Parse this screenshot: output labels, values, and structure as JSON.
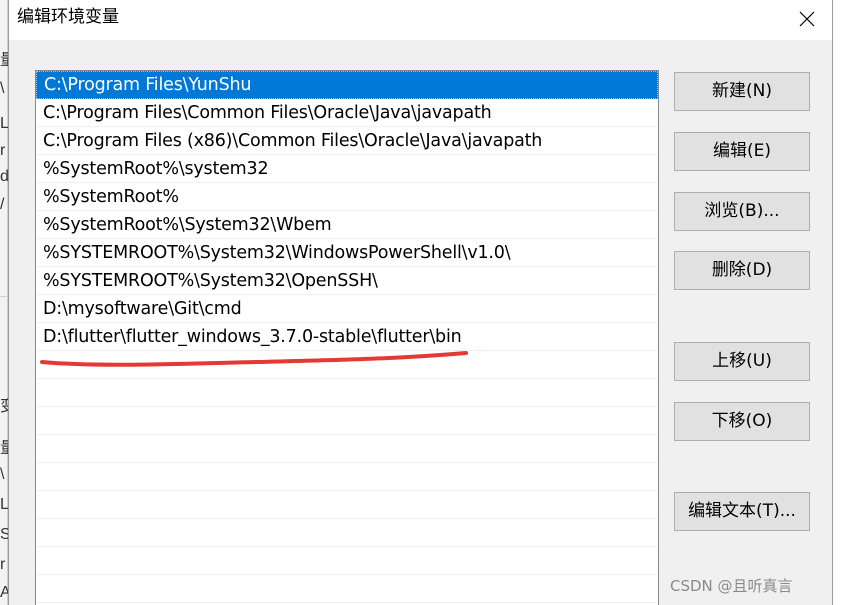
{
  "dialog": {
    "title": "编辑环境变量",
    "close_icon": "close-icon"
  },
  "background": {
    "chars": [
      "量",
      "\\",
      "L",
      "r",
      "d",
      "/",
      "变",
      "量",
      "\\",
      "L",
      "S",
      "r",
      "A"
    ]
  },
  "path_list": {
    "selected_index": 0,
    "highlight_color": "#0078d7",
    "annotation_color": "#e53935",
    "items": [
      "C:\\Program Files\\YunShu",
      "C:\\Program Files\\Common Files\\Oracle\\Java\\javapath",
      "C:\\Program Files (x86)\\Common Files\\Oracle\\Java\\javapath",
      "%SystemRoot%\\system32",
      "%SystemRoot%",
      "%SystemRoot%\\System32\\Wbem",
      "%SYSTEMROOT%\\System32\\WindowsPowerShell\\v1.0\\",
      "%SYSTEMROOT%\\System32\\OpenSSH\\",
      "D:\\mysoftware\\Git\\cmd",
      "D:\\flutter\\flutter_windows_3.7.0-stable\\flutter\\bin"
    ]
  },
  "buttons": {
    "new": "新建(N)",
    "edit": "编辑(E)",
    "browse": "浏览(B)...",
    "delete": "删除(D)",
    "move_up": "上移(U)",
    "move_down": "下移(O)",
    "edit_text": "编辑文本(T)..."
  },
  "watermark": "CSDN @且听真言"
}
